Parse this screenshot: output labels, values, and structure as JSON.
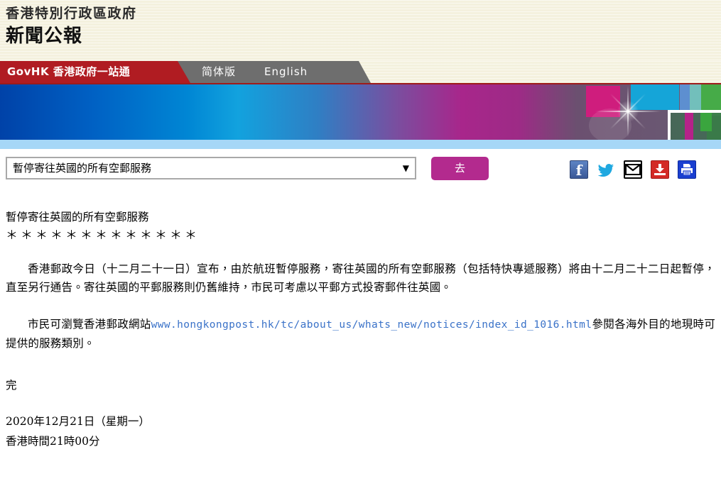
{
  "header": {
    "org_name": "香港特別行政區政府",
    "publication_name": "新聞公報"
  },
  "nav": {
    "govhk_label": "GovHK 香港政府一站通",
    "simplified_label": "简体版",
    "english_label": "English"
  },
  "controls": {
    "topic_select_value": "暫停寄往英國的所有空郵服務",
    "go_button_label": "去",
    "social_icons": [
      {
        "name": "facebook-icon",
        "label": "f"
      },
      {
        "name": "twitter-icon",
        "label": ""
      },
      {
        "name": "email-icon",
        "label": ""
      },
      {
        "name": "download-icon",
        "label": ""
      },
      {
        "name": "print-icon",
        "label": ""
      }
    ]
  },
  "article": {
    "headline": "暫停寄往英國的所有空郵服務",
    "stars": "＊＊＊＊＊＊＊＊＊＊＊＊＊",
    "paragraph_1": "香港郵政今日（十二月二十一日）宣布，由於航班暫停服務，寄往英國的所有空郵服務（包括特快專遞服務）將由十二月二十二日起暫停，直至另行通告。寄往英國的平郵服務則仍舊維持，市民可考慮以平郵方式投寄郵件往英國。",
    "paragraph_2_before": "市民可瀏覽香港郵政網站",
    "paragraph_2_url": "www.hongkongpost.hk/tc/about_us/whats_new/notices/index_id_1016.html",
    "paragraph_2_after": "參閱各海外目的地現時可提供的服務類別。",
    "end_mark": "完",
    "date": "2020年12月21日（星期一）",
    "time": "香港時間21時00分"
  },
  "colors": {
    "header_bg": "#f4f1de",
    "nav_red": "#b01c22",
    "nav_gray": "#6e6e6e",
    "go_button": "#b32a8e",
    "link_blue": "#3a72c8",
    "banner_underline": "#a6d7f7"
  }
}
